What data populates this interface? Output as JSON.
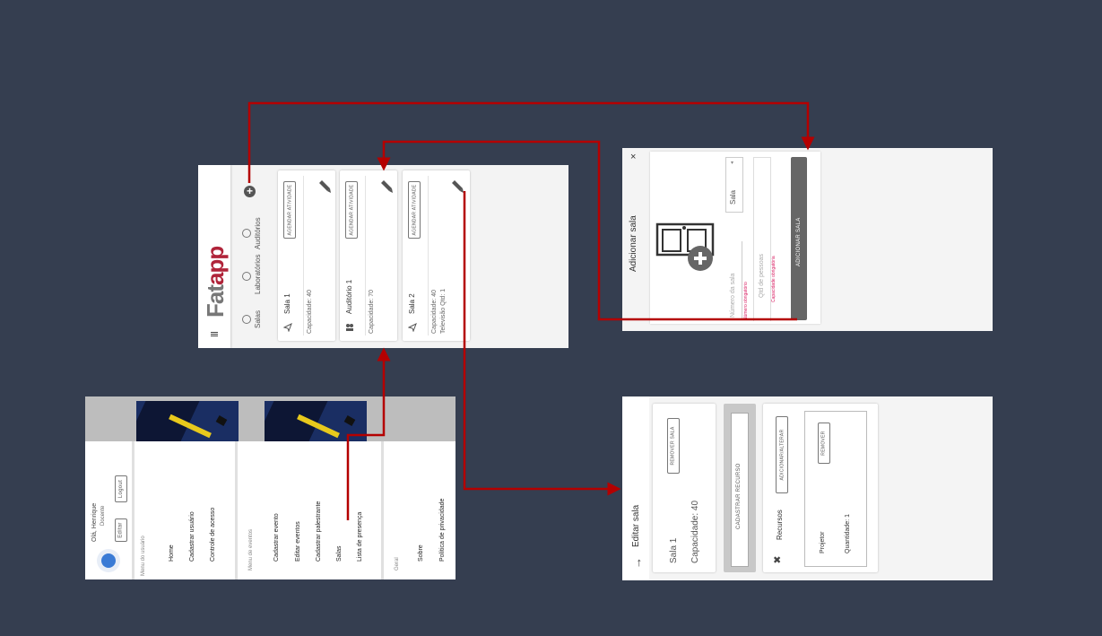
{
  "screens": {
    "rooms_list": {
      "menu_icon": "menu-icon",
      "logo": {
        "prefix": "Fat",
        "suffix": "app"
      },
      "filters": [
        {
          "label": "Salas"
        },
        {
          "label": "Laboratórios"
        },
        {
          "label": "Auditórios"
        }
      ],
      "add_icon": "plus-circle-icon",
      "cards": [
        {
          "icon": "send-icon",
          "name": "Sala 1",
          "details": [
            "Capacidade: 40"
          ],
          "action_label": "AGENDAR ATIVIDADE",
          "edit_icon": "pencil-icon"
        },
        {
          "icon": "people-icon",
          "name": "Auditório 1",
          "details": [
            "Capacidade: 70"
          ],
          "action_label": "AGENDAR ATIVIDADE",
          "edit_icon": "pencil-icon"
        },
        {
          "icon": "send-icon",
          "name": "Sala 2",
          "details": [
            "Capacidade: 40",
            "Televisão Qtd: 1"
          ],
          "action_label": "AGENDAR ATIVIDADE",
          "edit_icon": "pencil-icon"
        }
      ]
    },
    "add_room": {
      "close_label": "×",
      "title": "Adicionar sala",
      "type_select": {
        "value": "Sala"
      },
      "room_number": {
        "placeholder": "Número da sala",
        "error": "Número obrigatório"
      },
      "capacity": {
        "placeholder": "Qtd de pessoas",
        "error": "Capacidade obrigatória"
      },
      "submit_label": "ADICIONAR SALA"
    },
    "side_menu": {
      "user": {
        "greeting": "Olá, Henrique",
        "role": "Docente",
        "edit_label": "Editar",
        "logout_label": "Logout"
      },
      "sections": [
        {
          "title": "Menu do usuário",
          "items": [
            "Home",
            "Cadastrar usuário",
            "Controle de acesso"
          ]
        },
        {
          "title": "Menu de eventos",
          "items": [
            "Cadastrar evento",
            "Editar eventos",
            "Cadastrar palestrante",
            "Salas",
            "Lista de presença"
          ]
        },
        {
          "title": "Geral",
          "items": [
            "Sobre",
            "Política de privacidade"
          ]
        }
      ]
    },
    "edit_room": {
      "back_icon": "arrow-back-icon",
      "title": "Editar sala",
      "room_name": "Sala 1",
      "capacity": "Capacidade: 40",
      "remove_room_label": "REMOVER SALA",
      "register_resource_label": "CADASTRAR RECURSO",
      "resources_title": "Recursos",
      "add_edit_label": "ADICIONAR/ALTERAR",
      "resources": [
        {
          "name": "Projetor",
          "quantity": "Quantidade: 1",
          "remove_label": "REMOVER"
        }
      ]
    }
  },
  "colors": {
    "background": "#353e50",
    "wire": "#b40000",
    "logo_accent": "#b0243a",
    "error": "#d81b60"
  }
}
